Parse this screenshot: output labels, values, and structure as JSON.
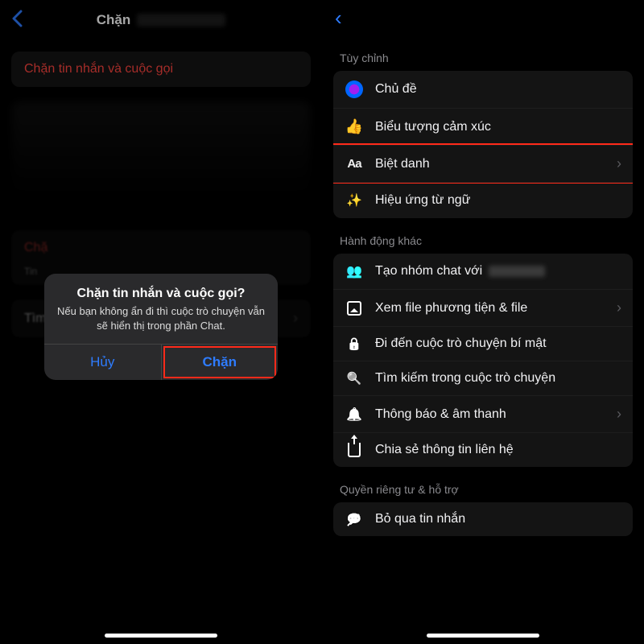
{
  "left": {
    "header_title": "Chặn",
    "block_label": "Chặn tin nhắn và cuộc gọi",
    "partial": {
      "row_prefix": "Chặ",
      "sub_prefix": "Tin"
    },
    "search_row": "Tìm",
    "alert": {
      "title": "Chặn tin nhắn và cuộc gọi?",
      "body": "Nếu bạn không ẩn đi thì cuộc trò chuyện vẫn sẽ hiển thị trong phần Chat.",
      "cancel": "Hủy",
      "confirm": "Chặn"
    }
  },
  "right": {
    "section_customize": "Tùy chỉnh",
    "customize": {
      "theme": "Chủ đề",
      "emoji": "Biểu tượng cảm xúc",
      "nickname": "Biệt danh",
      "word_effect": "Hiệu ứng từ ngữ"
    },
    "section_actions": "Hành động khác",
    "actions": {
      "create_group_prefix": "Tạo nhóm chat với",
      "media": "Xem file phương tiện & file",
      "secret": "Đi đến cuộc trò chuyện bí mật",
      "search": "Tìm kiếm trong cuộc trò chuyện",
      "notify": "Thông báo & âm thanh",
      "share": "Chia sẻ thông tin liên hệ"
    },
    "section_privacy": "Quyền riêng tư & hỗ trợ",
    "privacy": {
      "ignore": "Bỏ qua tin nhắn"
    }
  }
}
